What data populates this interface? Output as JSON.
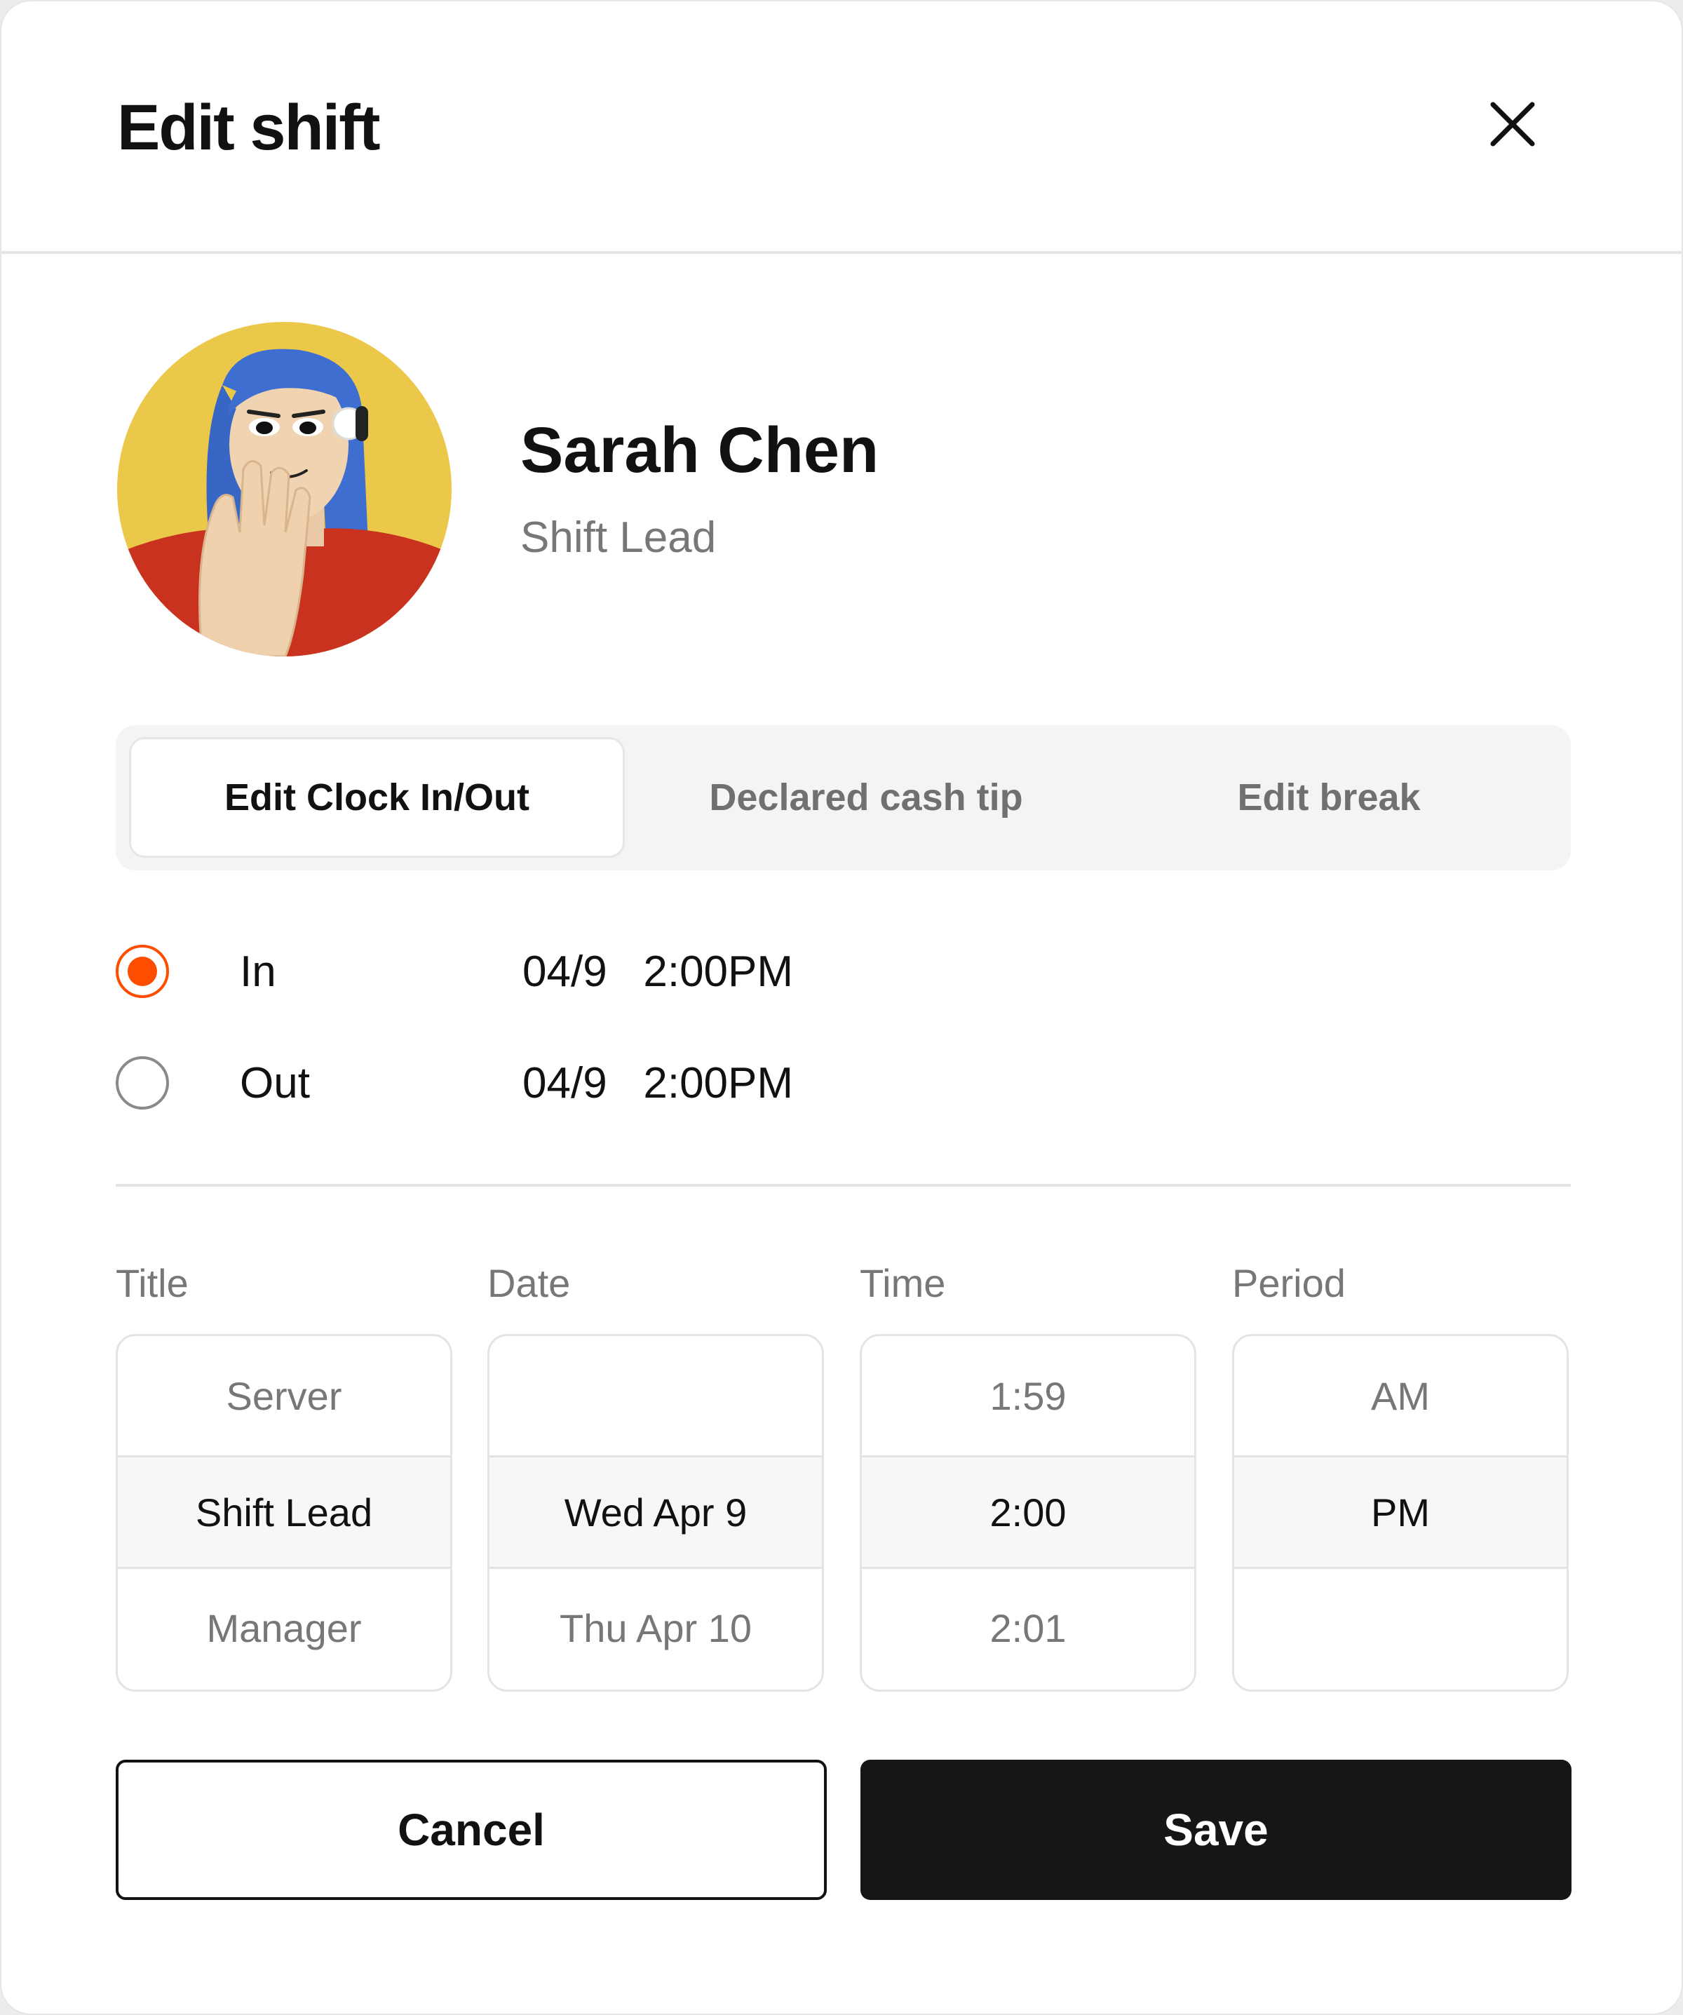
{
  "dialog": {
    "title": "Edit shift"
  },
  "profile": {
    "name": "Sarah Chen",
    "role": "Shift Lead"
  },
  "tabs": [
    {
      "label": "Edit Clock In/Out",
      "active": true
    },
    {
      "label": "Declared cash tip",
      "active": false
    },
    {
      "label": "Edit break",
      "active": false
    }
  ],
  "clock": [
    {
      "label": "In",
      "date": "04/9",
      "time": "2:00PM",
      "selected": true
    },
    {
      "label": "Out",
      "date": "04/9",
      "time": "2:00PM",
      "selected": false
    }
  ],
  "pickers": {
    "title": {
      "label": "Title",
      "options": [
        "Server",
        "Shift Lead",
        "Manager"
      ]
    },
    "date": {
      "label": "Date",
      "options": [
        "",
        "Wed Apr 9",
        "Thu Apr 10"
      ]
    },
    "time": {
      "label": "Time",
      "options": [
        "1:59",
        "2:00",
        "2:01"
      ]
    },
    "period": {
      "label": "Period",
      "options": [
        "AM",
        "PM",
        ""
      ]
    }
  },
  "actions": {
    "cancel_label": "Cancel",
    "save_label": "Save"
  },
  "colors": {
    "accent": "#ff4d00",
    "primary_button": "#161616",
    "avatar_background": "#ecc84a",
    "avatar_shirt": "#c8321e",
    "avatar_hair": "#3e6ed0"
  }
}
